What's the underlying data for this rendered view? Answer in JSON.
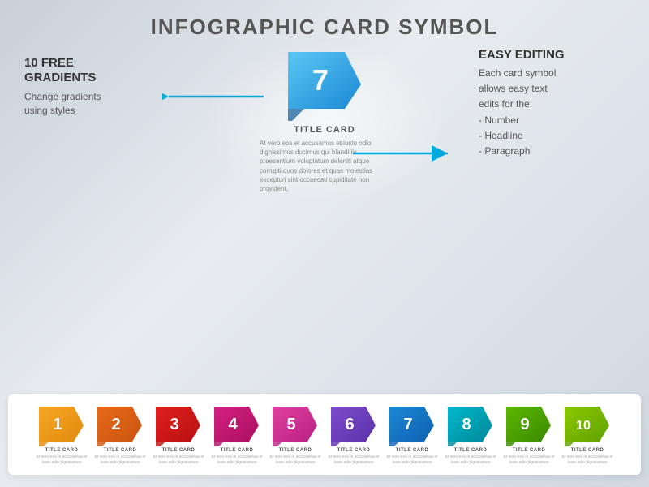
{
  "title": "INFOGRAPHIC CARD SYMBOL",
  "left_block": {
    "heading": "10 FREE\nGRADIENTS",
    "subtext": "Change gradients\nusing styles"
  },
  "right_block": {
    "heading": "EASY EDITING",
    "line1": "Each card symbol",
    "line2": "allows easy text",
    "line3": "edits for the:",
    "line4": "- Number",
    "line5": "- Headline",
    "line6": "- Paragraph"
  },
  "center_card": {
    "number": "7",
    "title": "TITLE CARD",
    "paragraph": "At vero eos et accusamus et iusto odio dignissimos ducimus qui blanditiis praesentium voluptatum deleniti atque corrupti quos dolores et quas molestias excepturi sint occaecati cupiditate non provident,"
  },
  "cards": [
    {
      "number": "1",
      "color": "#f5a623",
      "fold_color": "#e08b0f",
      "title": "TITLE CARD"
    },
    {
      "number": "2",
      "color": "#e8691a",
      "fold_color": "#c95510",
      "title": "TITLE CARD"
    },
    {
      "number": "3",
      "color": "#e02020",
      "fold_color": "#b81010",
      "title": "TITLE CARD"
    },
    {
      "number": "4",
      "color": "#d42080",
      "fold_color": "#aa1060",
      "title": "TITLE CARD"
    },
    {
      "number": "5",
      "color": "#e040a0",
      "fold_color": "#b82080",
      "title": "TITLE CARD"
    },
    {
      "number": "6",
      "color": "#7c4dcc",
      "fold_color": "#5c30aa",
      "title": "TITLE CARD"
    },
    {
      "number": "7",
      "color": "#1a88d4",
      "fold_color": "#1060b0",
      "title": "TITLE CARD"
    },
    {
      "number": "8",
      "color": "#00b8cc",
      "fold_color": "#008898",
      "title": "TITLE CARD"
    },
    {
      "number": "9",
      "color": "#5cb800",
      "fold_color": "#3a8800",
      "title": "TITLE CARD"
    },
    {
      "number": "10",
      "color": "#8cc800",
      "fold_color": "#60a000",
      "title": "TITLE CARD"
    }
  ],
  "arrow_color": "#00aadd"
}
